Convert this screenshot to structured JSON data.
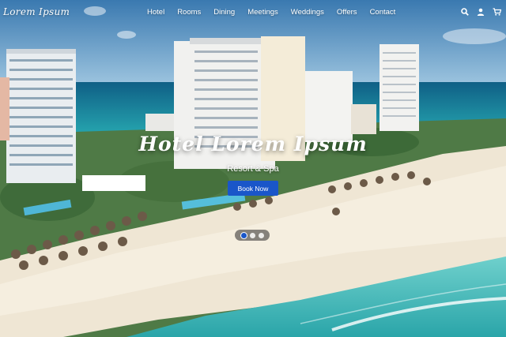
{
  "brand": {
    "name": "Lorem Ipsum"
  },
  "nav": {
    "items": [
      {
        "label": "Hotel"
      },
      {
        "label": "Rooms"
      },
      {
        "label": "Dining"
      },
      {
        "label": "Meetings"
      },
      {
        "label": "Weddings"
      },
      {
        "label": "Offers"
      },
      {
        "label": "Contact"
      }
    ]
  },
  "tools": {
    "search_icon": "search-icon",
    "user_icon": "user-icon",
    "cart_icon": "cart-icon"
  },
  "hero": {
    "title": "Hotel Lorem Ipsum",
    "subtitle": "Resort & Spa",
    "cta_label": "Book Now",
    "slides": 3,
    "active_slide": 1
  },
  "colors": {
    "accent": "#1a56c9",
    "sea": "#1fa2a8",
    "sky": "#4d8fc0",
    "sand": "#efe5d3"
  }
}
